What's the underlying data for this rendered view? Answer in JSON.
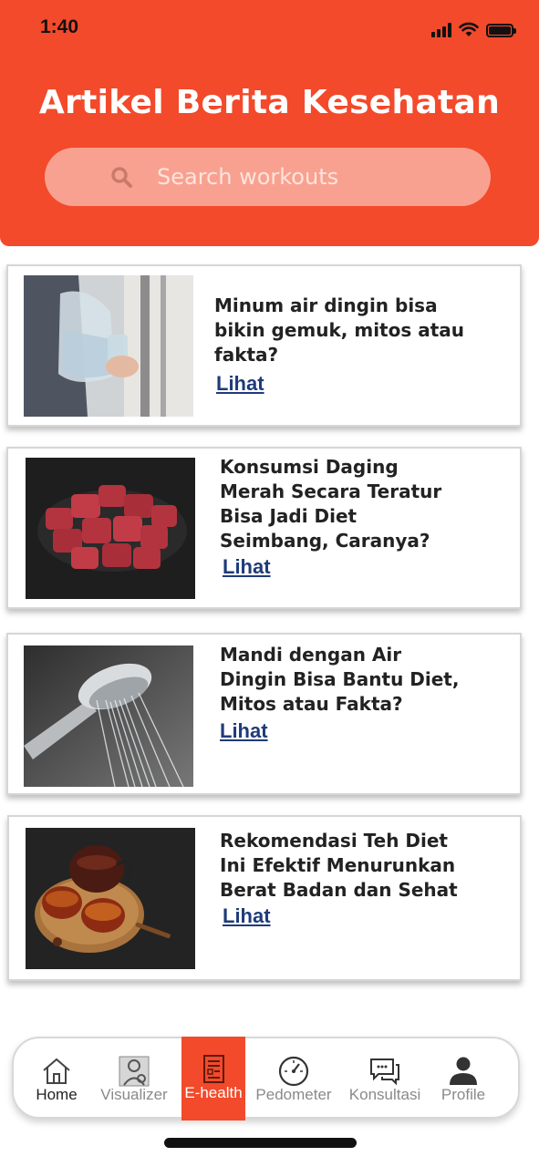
{
  "status_bar": {
    "time": "1:40"
  },
  "header": {
    "title": "Artikel Berita Kesehatan",
    "search_placeholder": "Search workouts"
  },
  "articles": [
    {
      "title_lines": [
        "Minum air dingin bisa",
        "bikin gemuk, mitos atau",
        "fakta?"
      ],
      "link_label": "Lihat",
      "image": "water-pitcher-photo"
    },
    {
      "title_lines": [
        "Konsumsi Daging",
        "Merah Secara Teratur",
        "Bisa Jadi Diet",
        "Seimbang, Caranya?"
      ],
      "link_label": "Lihat",
      "image": "red-meat-photo"
    },
    {
      "title_lines": [
        "Mandi dengan Air",
        "Dingin Bisa Bantu Diet,",
        "Mitos atau Fakta?"
      ],
      "link_label": "Lihat",
      "image": "shower-head-photo"
    },
    {
      "title_lines": [
        "Rekomendasi Teh Diet",
        "Ini Efektif Menurunkan",
        "Berat Badan dan Sehat"
      ],
      "link_label": "Lihat",
      "image": "tea-cups-photo"
    }
  ],
  "bottom_nav": {
    "items": [
      {
        "label": "Home",
        "icon": "home-icon"
      },
      {
        "label": "Visualizer",
        "icon": "visualizer-icon"
      },
      {
        "label": "E-health",
        "icon": "e-health-icon",
        "active": true
      },
      {
        "label": "Pedometer",
        "icon": "speedometer-icon"
      },
      {
        "label": "Konsultasi",
        "icon": "chat-icon"
      },
      {
        "label": "Profile",
        "icon": "user-icon"
      }
    ]
  },
  "colors": {
    "accent": "#f24a2b",
    "link": "#1f3b78"
  }
}
